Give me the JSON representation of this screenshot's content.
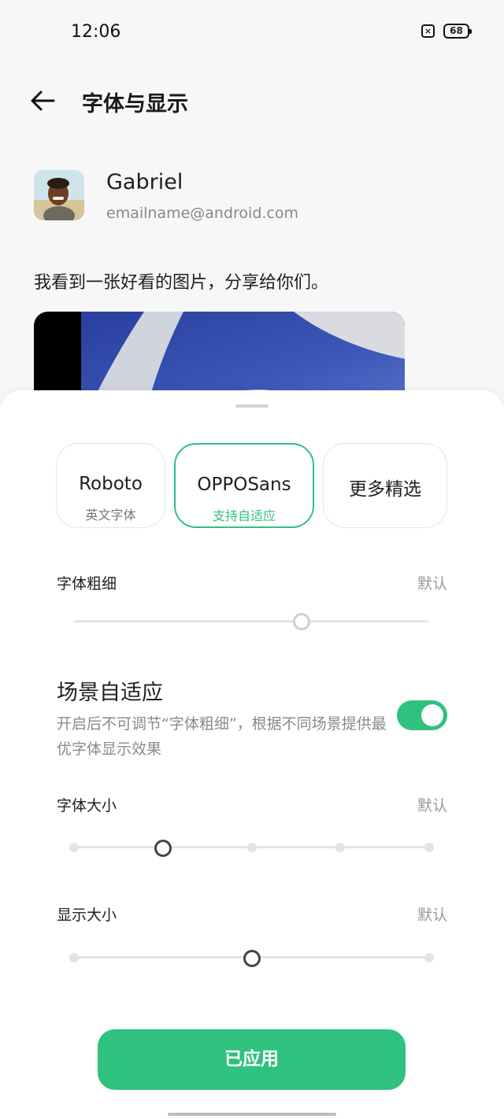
{
  "status_bar": {
    "time": "12:06",
    "sim_icon": "sim-x-icon",
    "battery_level": "68"
  },
  "header": {
    "title": "字体与显示",
    "back_icon": "arrow-left-icon"
  },
  "preview": {
    "user_name": "Gabriel",
    "user_email": "emailname@android.com",
    "message": "我看到一张好看的图片，分享给你们。"
  },
  "font_options": [
    {
      "title": "Roboto",
      "subtitle": "英文字体",
      "selected": false
    },
    {
      "title": "OPPOSans",
      "subtitle": "支持自适应",
      "selected": true
    },
    {
      "title": "更多精选",
      "subtitle": "",
      "selected": false
    }
  ],
  "font_weight": {
    "label": "字体粗细",
    "value": "默认",
    "level_fraction": 0.64
  },
  "scene_adaptive": {
    "title": "场景自适应",
    "description": "开启后不可调节“字体粗细”，根据不同场景提供最优字体显示效果",
    "enabled": true
  },
  "font_size": {
    "label": "字体大小",
    "value": "默认",
    "steps": 5,
    "selected_step": 2
  },
  "display_size": {
    "label": "显示大小",
    "value": "默认",
    "steps": 3,
    "selected_step": 2
  },
  "apply_button": {
    "label": "已应用"
  },
  "colors": {
    "accent": "#2ec27e",
    "background": "#f7f7f7",
    "sheet": "#ffffff"
  }
}
